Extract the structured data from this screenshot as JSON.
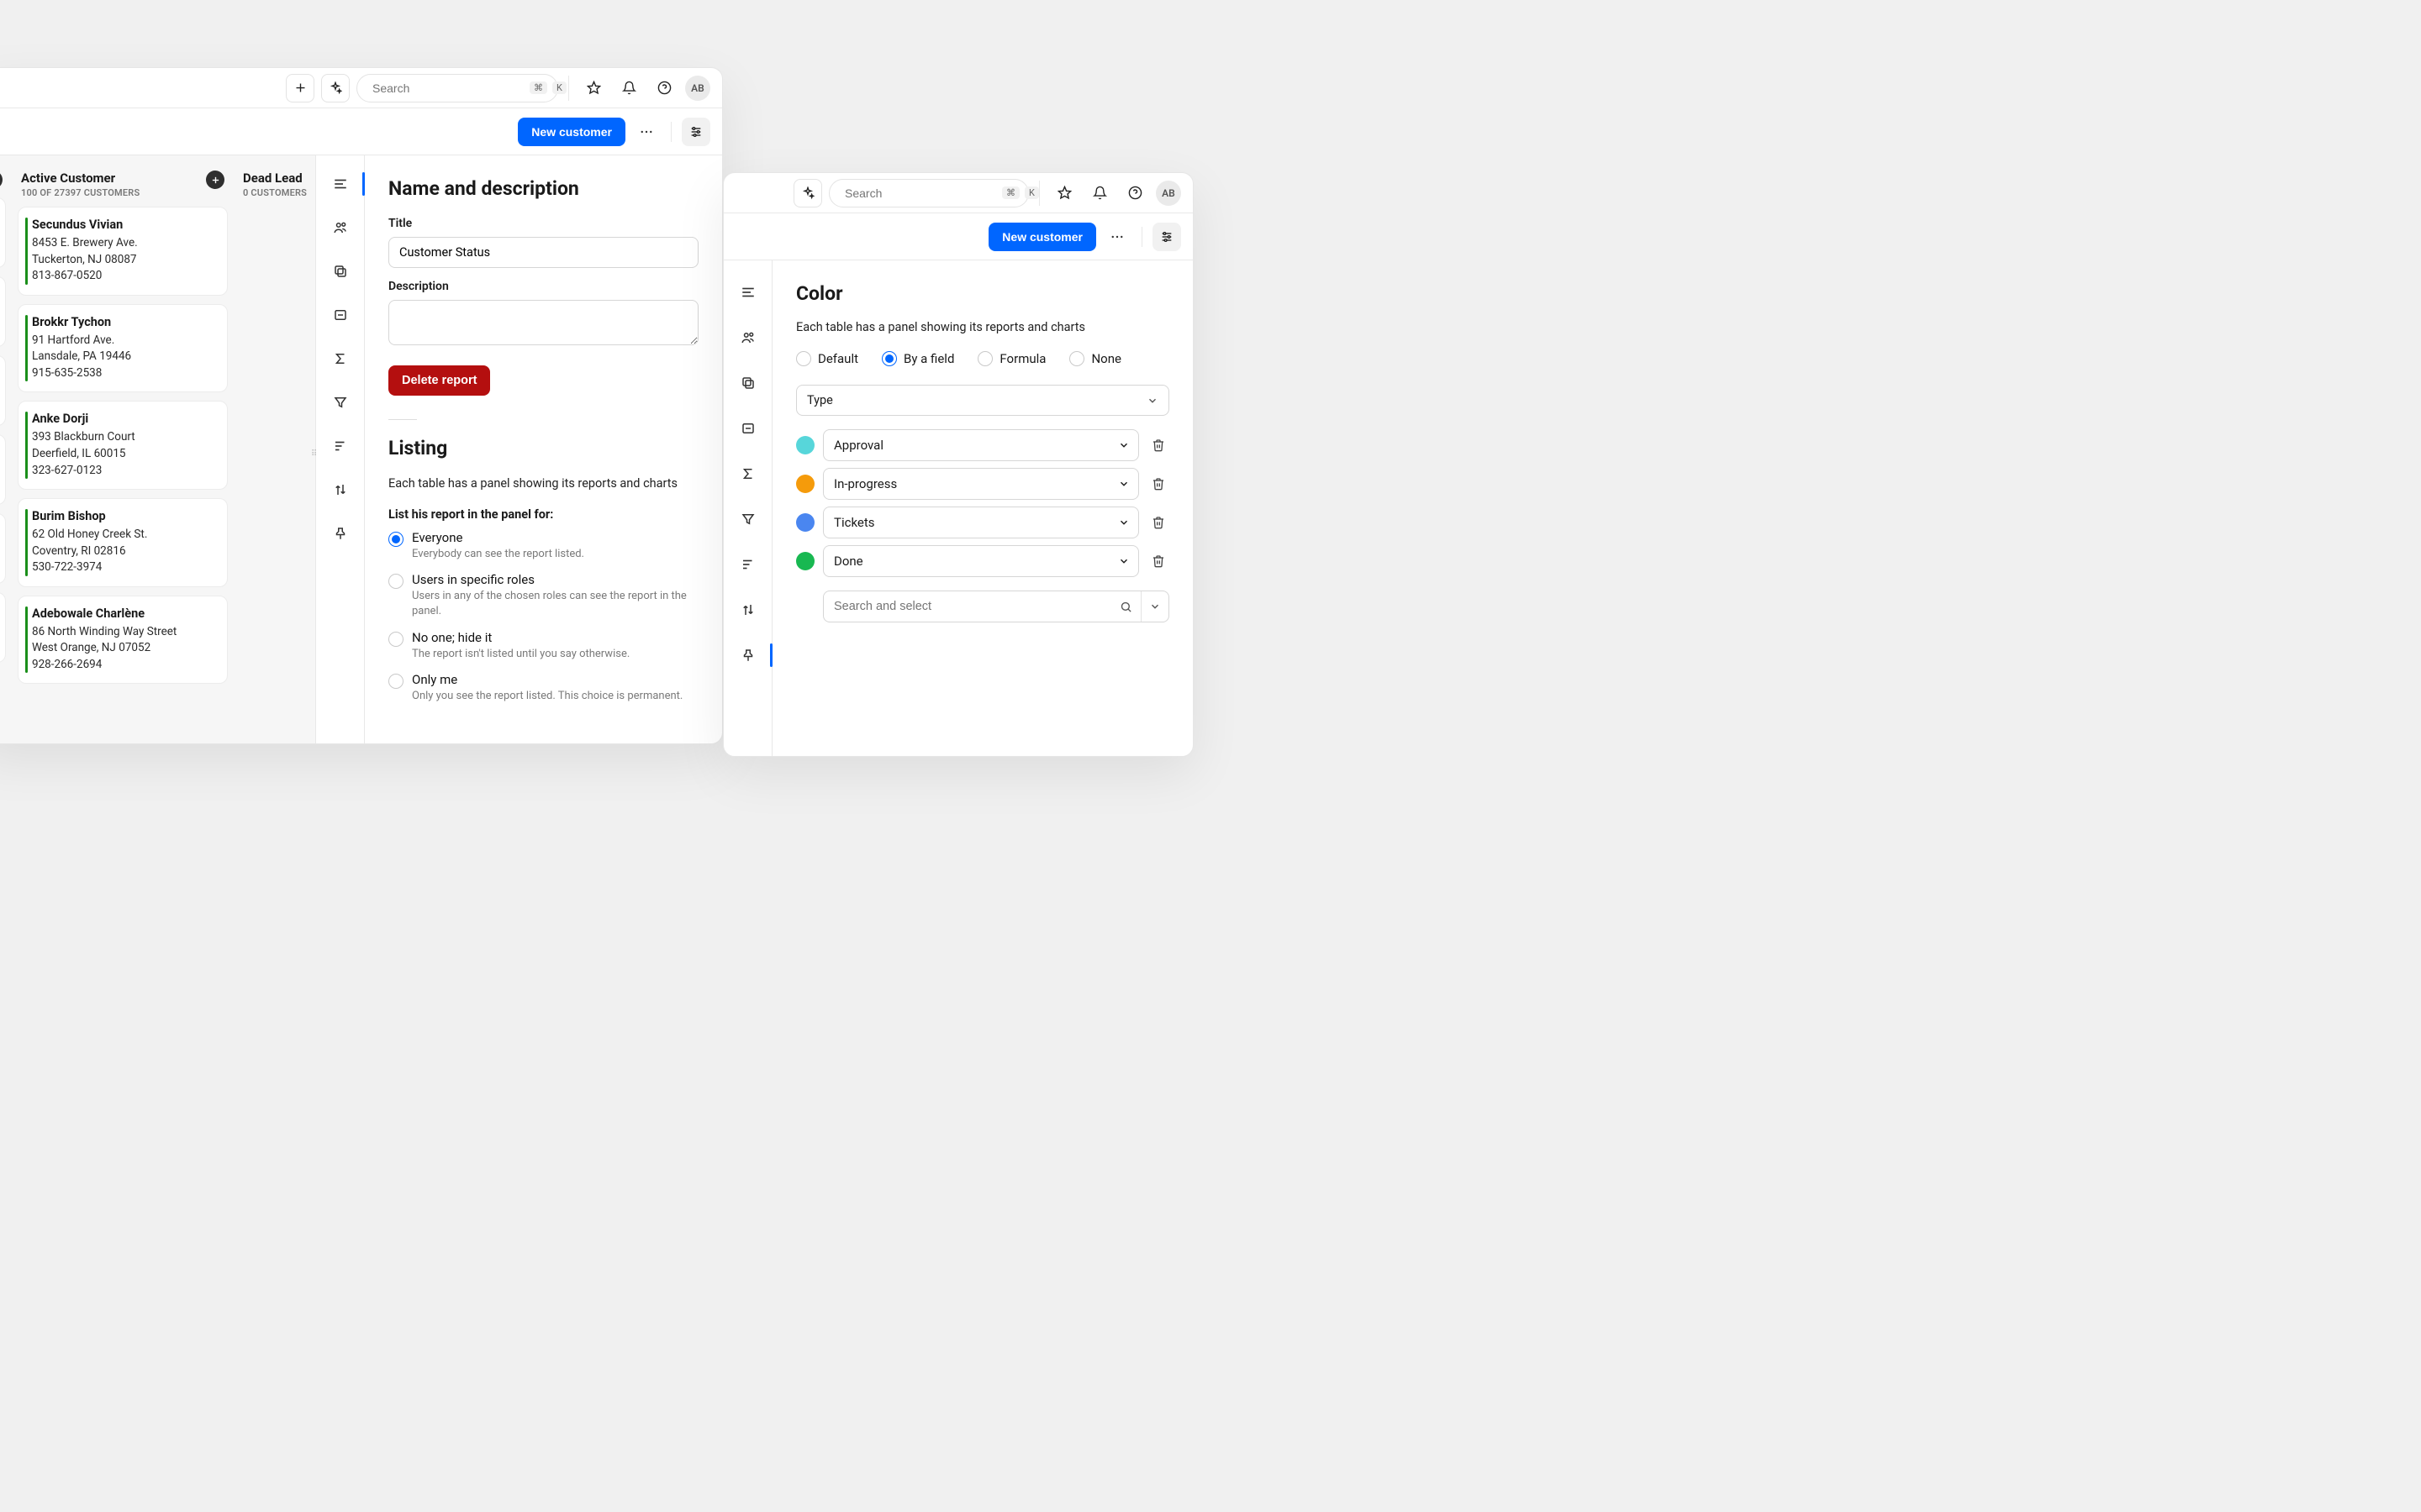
{
  "topbar": {
    "search_placeholder": "Search",
    "kbd1": "⌘",
    "kbd2": "K",
    "avatar": "AB"
  },
  "actionbar": {
    "new_customer": "New customer"
  },
  "kanban": {
    "col1": {
      "title": "Active Customer",
      "sub": "100 OF 27397 CUSTOMERS",
      "cards": [
        {
          "name": "Secundus Vivian",
          "l1": "8453 E. Brewery Ave.",
          "l2": "Tuckerton, NJ 08087",
          "l3": "813-867-0520"
        },
        {
          "name": "Brokkr Tychon",
          "l1": "91 Hartford Ave.",
          "l2": "Lansdale, PA 19446",
          "l3": "915-635-2538"
        },
        {
          "name": "Anke Dorji",
          "l1": "393 Blackburn Court",
          "l2": "Deerfield, IL 60015",
          "l3": "323-627-0123"
        },
        {
          "name": "Burim Bishop",
          "l1": "62 Old Honey Creek St.",
          "l2": "Coventry, RI 02816",
          "l3": "530-722-3974"
        },
        {
          "name": "Adebowale Charlène",
          "l1": "86 North Winding Way Street",
          "l2": "West Orange, NJ 07052",
          "l3": "928-266-2694"
        }
      ]
    },
    "col2": {
      "title": "Dead Lead",
      "sub": "0 CUSTOMERS"
    }
  },
  "panel1": {
    "heading1": "Name and description",
    "title_label": "Title",
    "title_value": "Customer Status",
    "desc_label": "Description",
    "delete_label": "Delete report",
    "heading2": "Listing",
    "listing_desc": "Each table has a panel showing its reports and charts",
    "list_for": "List his report in the panel for:",
    "radios": [
      {
        "label": "Everyone",
        "hint": "Everybody can see the report listed."
      },
      {
        "label": "Users in specific roles",
        "hint": "Users in any of the chosen roles can see the report in the panel."
      },
      {
        "label": "No one; hide it",
        "hint": "The report isn't listed until you say otherwise."
      },
      {
        "label": "Only me",
        "hint": "Only you see the report listed. This choice is permanent."
      }
    ]
  },
  "panel2": {
    "heading": "Color",
    "desc": "Each table has a panel showing its reports and charts",
    "opts": {
      "o1": "Default",
      "o2": "By a field",
      "o3": "Formula",
      "o4": "None"
    },
    "type_label": "Type",
    "rows": [
      {
        "color": "#57d6da",
        "label": "Approval"
      },
      {
        "color": "#f59b0b",
        "label": "In-progress"
      },
      {
        "color": "#4a86f0",
        "label": "Tickets"
      },
      {
        "color": "#18b851",
        "label": "Done"
      }
    ],
    "search_placeholder": "Search and select"
  }
}
